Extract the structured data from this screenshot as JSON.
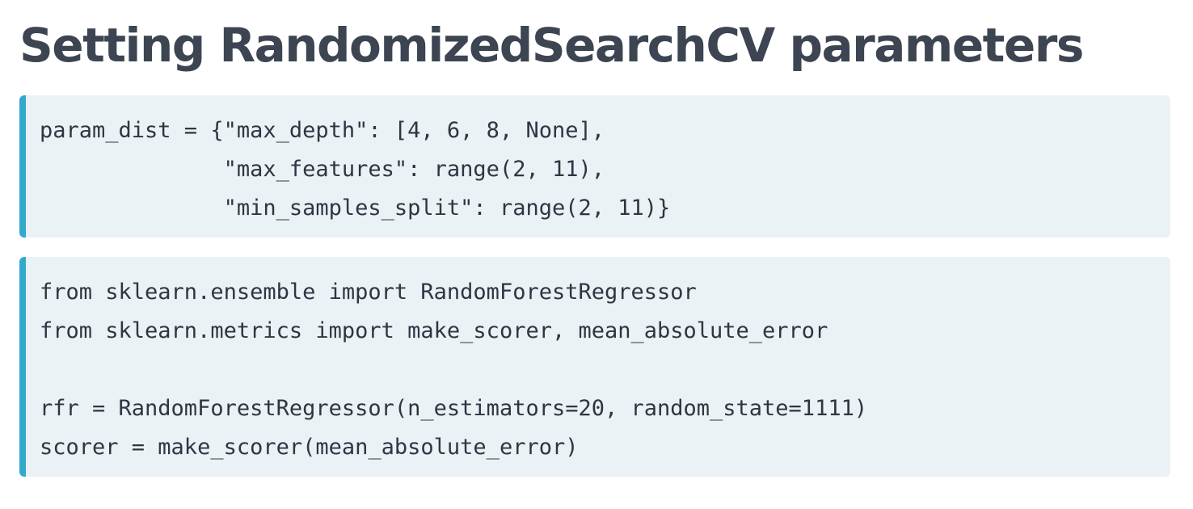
{
  "title": "Setting RandomizedSearchCV parameters",
  "code_blocks": [
    {
      "lines": [
        "param_dist = {\"max_depth\": [4, 6, 8, None],",
        "              \"max_features\": range(2, 11),",
        "              \"min_samples_split\": range(2, 11)}"
      ]
    },
    {
      "lines": [
        "from sklearn.ensemble import RandomForestRegressor",
        "from sklearn.metrics import make_scorer, mean_absolute_error",
        "",
        "rfr = RandomForestRegressor(n_estimators=20, random_state=1111)",
        "scorer = make_scorer(mean_absolute_error)"
      ]
    }
  ],
  "colors": {
    "title": "#3d4452",
    "code_background": "#eaf2f5",
    "code_accent": "#33aacc",
    "code_text": "#2f3542"
  }
}
